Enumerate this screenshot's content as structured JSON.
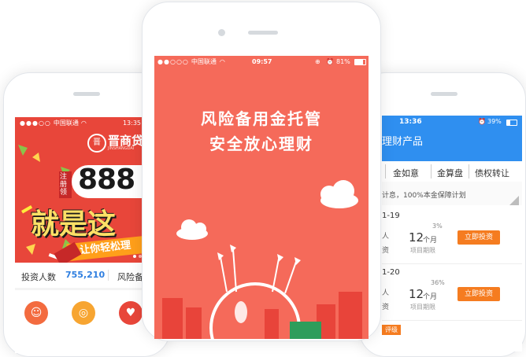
{
  "left_phone": {
    "status": {
      "carrier": "中国联通",
      "time": "13:35"
    },
    "banner": {
      "logo_text": "晋商贷",
      "logo_sub": "JINSHANGDAI",
      "register_tag": "注册领",
      "amount": "888",
      "slogan": "就是这",
      "ribbon": "让你轻松理"
    },
    "stats": {
      "label": "投资人数",
      "value": "755,210",
      "label2": "风险备"
    }
  },
  "center_phone": {
    "status": {
      "carrier": "中国联通",
      "time": "09:57",
      "battery": "81%"
    },
    "headline_line1": "风险备用金托管",
    "headline_line2": "安全放心理财",
    "colors": {
      "background": "#f56a5a",
      "accent": "#ffffff"
    }
  },
  "right_phone": {
    "status": {
      "time": "13:36",
      "battery": "39%"
    },
    "header_title": "理财产品",
    "tabs": [
      "金如意",
      "金算盘",
      "债权转让"
    ],
    "notice": "计息，100%本金保障计划",
    "products": [
      {
        "date": "1-19",
        "rate": "3%",
        "rate_prefix": "人",
        "term_value": "12",
        "term_unit": "个月",
        "term_label": "项目期限",
        "left_label": "资",
        "button": "立即投资"
      },
      {
        "date": "1-20",
        "rate": "36%",
        "rate_prefix": "人",
        "term_value": "12",
        "term_unit": "个月",
        "term_label": "项目期限",
        "left_label": "资",
        "button": "立即投资"
      }
    ],
    "bottom_tag": "评级",
    "colors": {
      "header": "#2f8ff0",
      "button": "#f57c20"
    }
  }
}
